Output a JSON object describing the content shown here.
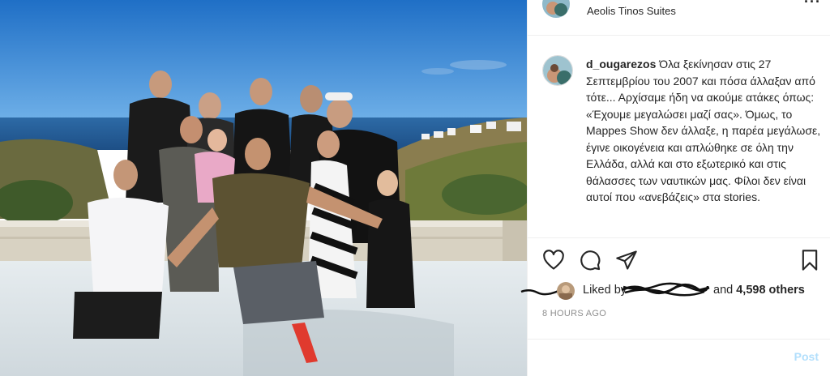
{
  "post": {
    "location": "Aeolis Tinos Suites",
    "more_icon": "more-horizontal-icon",
    "caption": {
      "username": "d_ougarezos",
      "text": "Όλα ξεκίνησαν στις 27 Σεπτεμβρίου του 2007 και πόσα άλλαξαν από τότε... Αρχίσαμε ήδη να ακούμε ατάκες όπως: «Έχουμε μεγαλώσει μαζί σας». Όμως, το Mappes Show δεν άλλαξε, η παρέα μεγάλωσε, έγινε οικογένεια και απλώθηκε σε όλη την Ελλάδα, αλλά και στο εξωτερικό και στις θάλασσες των ναυτικών μας. Φίλοι δεν είναι αυτοί που «ανεβάζεις» στα stories."
    },
    "actions": {
      "like_icon": "heart-icon",
      "comment_icon": "comment-bubble-icon",
      "share_icon": "paper-plane-icon",
      "save_icon": "bookmark-icon"
    },
    "likes": {
      "prefix": "Liked by",
      "and": "and",
      "others": "4,598 others"
    },
    "timestamp": "8 HOURS AGO",
    "post_button": "Post"
  },
  "colors": {
    "text": "#262626",
    "secondary": "#8e8e8e",
    "post_button_disabled": "#b2dffc",
    "border": "#efefef",
    "sky": "#2f7fd0",
    "sea": "#1f5f9e"
  }
}
